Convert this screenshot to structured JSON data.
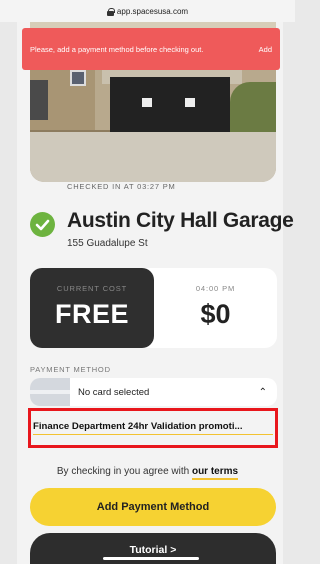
{
  "browser": {
    "url": "app.spacesusa.com"
  },
  "toast": {
    "message": "Please, add a payment method before checking out.",
    "action": "Add",
    "color": "#ef5a5a"
  },
  "checkin": {
    "status": "CHECKED IN AT 03:27 PM",
    "garage_name": "Austin City Hall Garage",
    "address": "155 Guadalupe St"
  },
  "cost": {
    "current_label": "CURRENT COST",
    "current_value": "FREE",
    "time_label": "04:00 PM",
    "time_value": "$0"
  },
  "payment": {
    "section_label": "PAYMENT METHOD",
    "selected": "No card selected",
    "promo": "Finance Department 24hr Validation promoti..."
  },
  "terms": {
    "prefix": "By checking in you agree with ",
    "link": "our terms"
  },
  "buttons": {
    "add_payment": "Add Payment Method",
    "tutorial": "Tutorial",
    "tutorial_chevron": ">"
  },
  "icons": [
    "lock-icon",
    "check-circle-icon",
    "card-icon",
    "chevron-up-icon",
    "chevron-right-icon"
  ],
  "colors": {
    "accent": "#f6d232",
    "success": "#6db33f",
    "highlight": "#e8161c",
    "dark": "#2f2f2f"
  }
}
